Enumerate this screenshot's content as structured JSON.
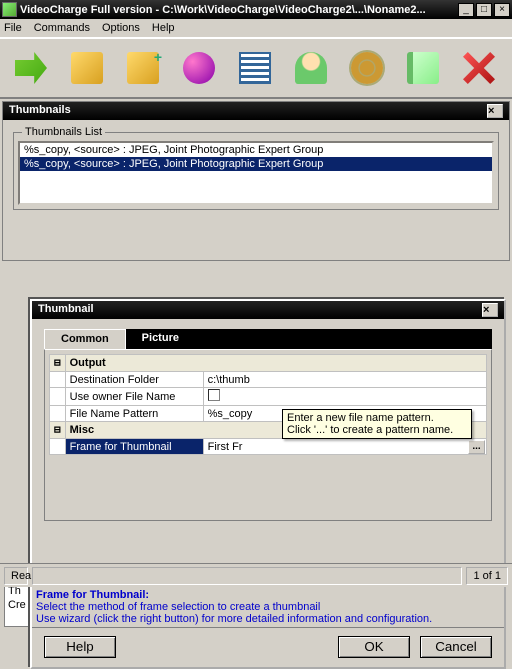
{
  "titlebar": {
    "title": "VideoCharge Full version - C:\\Work\\VideoCharge\\VideoCharge2\\...\\Noname2..."
  },
  "menu": {
    "file": "File",
    "commands": "Commands",
    "options": "Options",
    "help": "Help"
  },
  "thumbnails_panel": {
    "title": "Thumbnails",
    "list_label": "Thumbnails List",
    "items": [
      "%s_copy, <source> : JPEG, Joint Photographic Expert Group",
      "%s_copy, <source> : JPEG, Joint Photographic Expert Group"
    ]
  },
  "behind": {
    "l1": "Th",
    "l2": "Cre"
  },
  "dialog": {
    "title": "Thumbnail",
    "tabs": {
      "common": "Common",
      "picture": "Picture"
    },
    "grid": {
      "cat_output": "Output",
      "dest_folder_l": "Destination Folder",
      "dest_folder_v": "c:\\thumb",
      "owner_l": "Use owner File Name",
      "pattern_l": "File Name Pattern",
      "pattern_v": "%s_copy",
      "cat_misc": "Misc",
      "frame_l": "Frame for Thumbnail",
      "frame_v": "First Fr"
    },
    "tooltip": "Enter a new file name pattern.\nClick '...' to create a pattern name.",
    "help": {
      "title": "Frame for Thumbnail:",
      "line1": "Select the method of frame selection to create a thumbnail",
      "line2": "Use wizard (click the right button) for more detailed information and configuration."
    },
    "btn_help": "Help",
    "btn_ok": "OK",
    "btn_cancel": "Cancel"
  },
  "status": {
    "ready": "Rea",
    "pages": "1 of 1"
  }
}
